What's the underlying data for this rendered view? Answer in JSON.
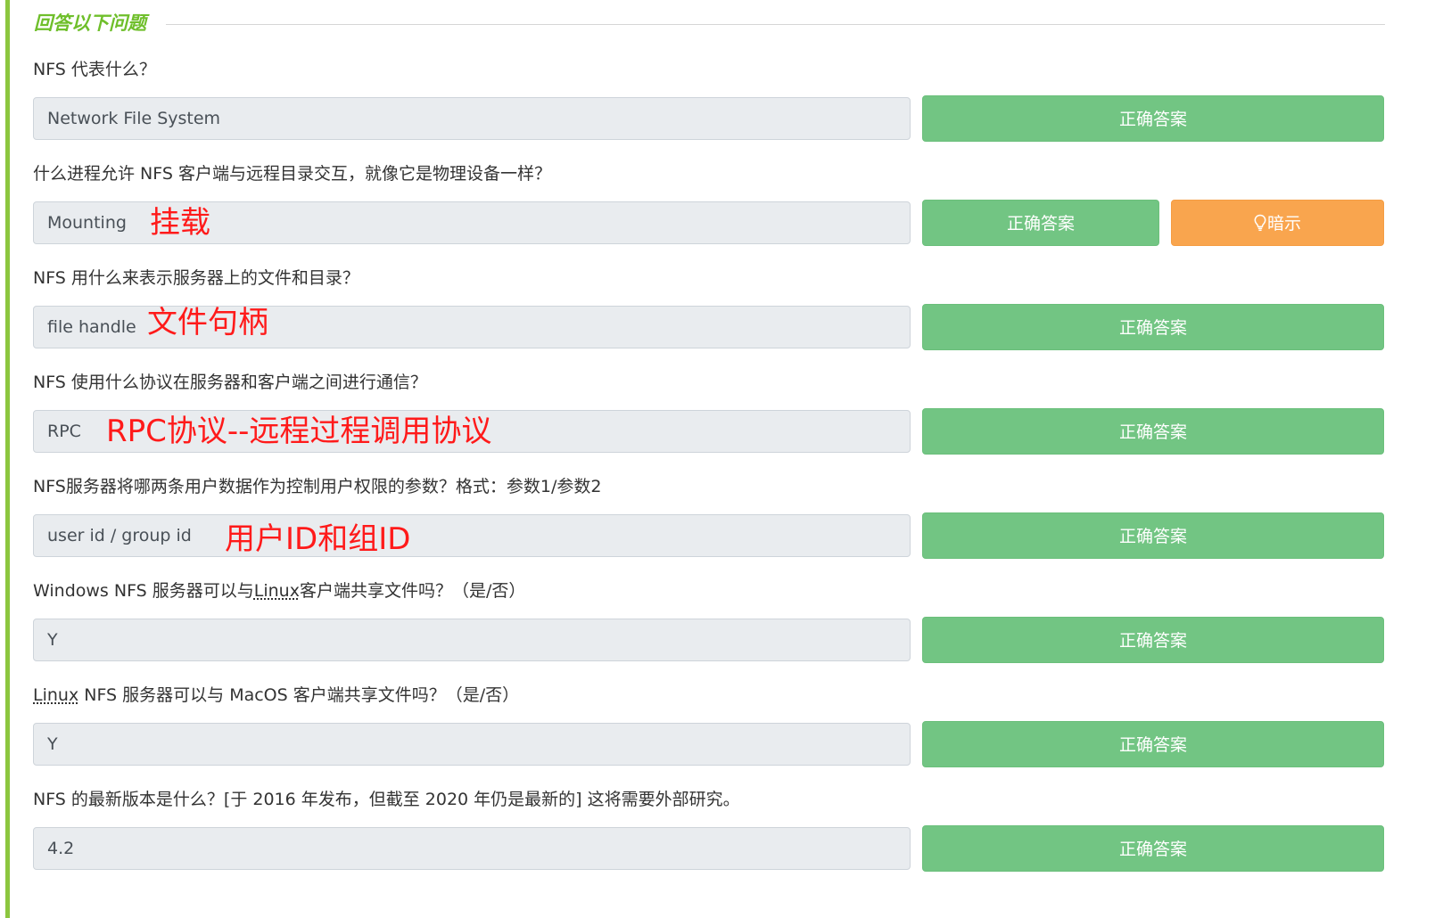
{
  "section": {
    "title": "回答以下问题"
  },
  "buttons": {
    "answer_label": "正确答案",
    "hint_label": "暗示",
    "hint_icon": "lightbulb-icon"
  },
  "colors": {
    "accent_green": "#8cc63f",
    "title_green": "#6fbf2b",
    "answer_button": "#72c583",
    "hint_button": "#f9a54e",
    "annotation_red": "#ff1a1a"
  },
  "questions": [
    {
      "text": "NFS 代表什么？",
      "answer_value": "Network File System",
      "annotation": ""
    },
    {
      "text": "什么进程允许 NFS 客户端与远程目录交互，就像它是物理设备一样？",
      "answer_value": "Mounting",
      "annotation": "挂载"
    },
    {
      "text": "NFS 用什么来表示服务器上的文件和目录？",
      "answer_value": "file handle",
      "annotation": "文件句柄"
    },
    {
      "text": "NFS 使用什么协议在服务器和客户端之间进行通信？",
      "answer_value": "RPC",
      "annotation": "RPC协议--远程过程调用协议"
    },
    {
      "text": "NFS服务器将哪两条用户数据作为控制用户权限的参数？格式：参数1/参数2",
      "answer_value": "user id / group id",
      "annotation": "用户ID和组ID"
    },
    {
      "text_before": "Windows NFS 服务器可以与",
      "text_abbr": "Linux",
      "text_after": "客户端共享文件吗？（是/否）",
      "answer_value": "Y",
      "annotation": ""
    },
    {
      "text_before": "",
      "text_abbr": "Linux",
      "text_after": " NFS 服务器可以与 MacOS 客户端共享文件吗？（是/否）",
      "answer_value": "Y",
      "annotation": ""
    },
    {
      "text": "NFS 的最新版本是什么？[于 2016 年发布，但截至 2020 年仍是最新的] 这将需要外部研究。",
      "answer_value": "4.2",
      "annotation": ""
    }
  ]
}
